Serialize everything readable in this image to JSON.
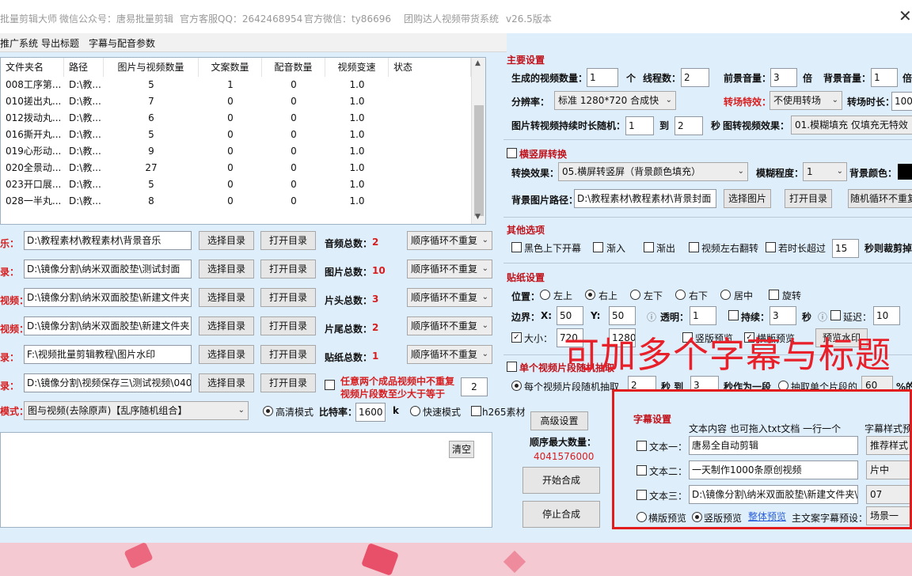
{
  "titlebar": {
    "app": "批量剪辑大师",
    "wechat": "微信公众号：唐易批量剪辑",
    "qq": "官方客服QQ：2642468954",
    "weixin": "官方微信：ty86696",
    "system": "团购达人视频带货系统",
    "version": "v26.5版本",
    "close_icon": "close-icon"
  },
  "menu": [
    "推广系统",
    "导出标题",
    "字幕与配音参数"
  ],
  "table": {
    "headers": [
      "文件夹名",
      "路径",
      "图片与视频数量",
      "文案数量",
      "配音数量",
      "视频变速",
      "状态"
    ],
    "rows": [
      [
        "008工序第...",
        "D:\\教...",
        "5",
        "1",
        "0",
        "1.0"
      ],
      [
        "010搓出丸...",
        "D:\\教...",
        "7",
        "0",
        "0",
        "1.0"
      ],
      [
        "012拨动丸...",
        "D:\\教...",
        "6",
        "0",
        "0",
        "1.0"
      ],
      [
        "016撕开丸...",
        "D:\\教...",
        "5",
        "0",
        "0",
        "1.0"
      ],
      [
        "019心形动...",
        "D:\\教...",
        "9",
        "0",
        "0",
        "1.0"
      ],
      [
        "020全景动...",
        "D:\\教...",
        "27",
        "0",
        "0",
        "1.0"
      ],
      [
        "023开口展...",
        "D:\\教...",
        "5",
        "0",
        "0",
        "1.0"
      ],
      [
        "028一半丸...",
        "D:\\教...",
        "8",
        "0",
        "0",
        "1.0"
      ]
    ]
  },
  "paths": [
    {
      "label": "乐：",
      "path": "D:\\教程素材\\教程素材\\背景音乐",
      "stat_label": "音频总数：",
      "stat": "2",
      "mode": "顺序循环不重复"
    },
    {
      "label": "录：",
      "path": "D:\\镜像分割\\纳米双面胶垫\\测试封面",
      "stat_label": "图片总数：",
      "stat": "10",
      "mode": "顺序循环不重复"
    },
    {
      "label": "视频：",
      "path": "D:\\镜像分割\\纳米双面胶垫\\新建文件夹",
      "stat_label": "片头总数：",
      "stat": "3",
      "mode": "顺序循环不重复"
    },
    {
      "label": "视频：",
      "path": "D:\\镜像分割\\纳米双面胶垫\\新建文件夹",
      "stat_label": "片尾总数：",
      "stat": "2",
      "mode": "顺序循环不重复"
    },
    {
      "label": "录：",
      "path": "F:\\视频批量剪辑教程\\图片水印",
      "stat_label": "贴纸总数：",
      "stat": "1",
      "mode": "顺序循环不重复"
    },
    {
      "label": "录：",
      "path": "D:\\镜像分割\\视频保存三\\测试视频\\040",
      "stat_label": "",
      "stat": "",
      "mode": ""
    }
  ],
  "choose_dir": "选择目录",
  "open_dir": "打开目录",
  "nodup": {
    "text1": "任意两个成品视频中不重复",
    "text2": "视频片段数至少大于等于",
    "value": "2"
  },
  "mode_row": {
    "label": "模式：",
    "select": "图与视频(去除原声)【乱序随机组合】",
    "hd": "高清模式",
    "bitrate_label": "比特率：",
    "bitrate": "1600",
    "k": "k",
    "fast": "快速模式",
    "h265": "h265素材"
  },
  "log": {
    "clear": "清空"
  },
  "actions": {
    "advanced": "高级设置",
    "max_label": "顺序最大数量：",
    "max_value": "4041576000",
    "start": "开始合成",
    "stop": "停止合成"
  },
  "main": {
    "title": "主要设置",
    "count_label": "生成的视频数量：",
    "count": "1",
    "unit_ge": "个",
    "threads_label": "线程数：",
    "threads": "2",
    "fg_label": "前景音量：",
    "fg": "3",
    "bei": "倍",
    "bg_label": "背景音量：",
    "bg": "1",
    "bei2": "倍",
    "res_label": "分辨率：",
    "res": "标准 1280*720 合成快",
    "trans_label": "转场特效：",
    "trans": "不使用转场",
    "trans_dur_label": "转场时长：",
    "trans_dur": "100",
    "img_dur_label": "图片转视频持续时长随机：",
    "img_min": "1",
    "to": "到",
    "img_max": "2",
    "sec": "秒",
    "img_effect_label": "图转视频效果：",
    "img_effect": "01.模糊填充 仅填充无特效"
  },
  "hv": {
    "title": "横竖屏转换",
    "effect_label": "转换效果：",
    "effect": "05.横屏转竖屏（背景颜色填充）",
    "blur_label": "模糊程度：",
    "blur": "1",
    "bgcolor_label": "背景颜色：",
    "bgpath_label": "背景图片路径：",
    "bgpath": "D:\\教程素材\\教程素材\\背景封面",
    "choose_img": "选择图片",
    "open_dir": "打开目录",
    "random": "随机循环不重复"
  },
  "other": {
    "title": "其他选项",
    "opts": [
      "黑色上下开幕",
      "渐入",
      "渐出",
      "视频左右翻转",
      "若时长超过"
    ],
    "secs": "15",
    "tail": "秒则裁剪掉"
  },
  "sticker": {
    "title": "贴纸设置",
    "pos_label": "位置：",
    "positions": [
      "左上",
      "右上",
      "左下",
      "右下",
      "居中"
    ],
    "rotate": "旋转",
    "margin_label": "边界：",
    "x_label": "X:",
    "x": "50",
    "y_label": "Y:",
    "y": "50",
    "alpha_label": "透明：",
    "alpha": "1",
    "dur_label": "持续：",
    "dur": "3",
    "sec": "秒",
    "delay_label": "延迟：",
    "delay": "10",
    "size_label": "大小：",
    "w": "720",
    "h": "1280",
    "vert_preview": "竖版预览",
    "horiz_preview": "横版预览",
    "watermark_btn": "预览水印"
  },
  "overlay": "可加多个字幕与标题",
  "segment": {
    "title": "单个视频片段随机抽取",
    "each": "每个视频片段随机抽取",
    "min": "2",
    "sec_to": "秒 到",
    "max": "3",
    "as": "秒作为一段",
    "single": "抽取单个片段的",
    "pct": "60",
    "pct_label": "%的"
  },
  "subtitle": {
    "title": "字幕设置",
    "content_header": "文本内容 也可拖入txt文档 一行一个",
    "style_header": "字幕样式预设",
    "rows": [
      {
        "label": "文本一：",
        "text": "唐易全自动剪辑",
        "style": "推荐样式"
      },
      {
        "label": "文本二：",
        "text": "一天制作1000条原创视频",
        "style": "片中"
      },
      {
        "label": "文本三：",
        "text": "D:\\镜像分割\\纳米双面胶垫\\新建文件夹\\",
        "style": "07"
      }
    ],
    "horiz": "横版预览",
    "vert": "竖版预览",
    "whole": "整体预览",
    "main_style_label": "主文案字幕预设：",
    "main_style": "场景一"
  }
}
